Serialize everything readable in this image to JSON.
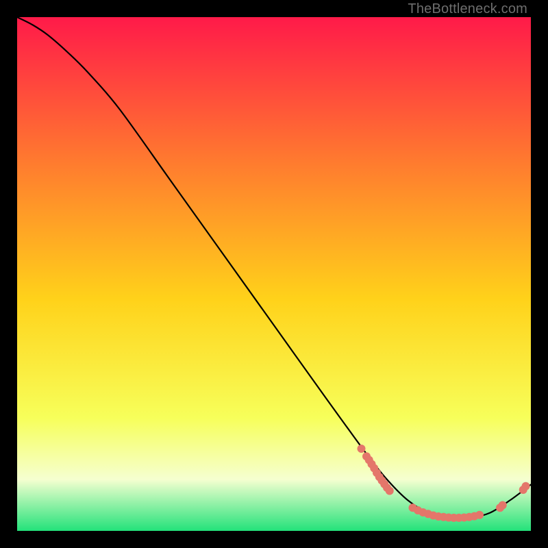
{
  "watermark": "TheBottleneck.com",
  "colors": {
    "top": "#ff1a49",
    "mid_upper": "#ff7a2f",
    "mid": "#ffd21a",
    "mid_lower": "#f7ff5a",
    "pale": "#f5ffd0",
    "green": "#23e27a",
    "curve": "#000000",
    "dot": "#e4766a",
    "bg": "#000000"
  },
  "chart_data": {
    "type": "line",
    "title": "",
    "xlabel": "",
    "ylabel": "",
    "xlim": [
      0,
      100
    ],
    "ylim": [
      0,
      100
    ],
    "curve": {
      "x": [
        0,
        3,
        6,
        10,
        14,
        20,
        30,
        40,
        50,
        60,
        68,
        72,
        76,
        80,
        84,
        88,
        92,
        96,
        100
      ],
      "y": [
        100,
        98.5,
        96.5,
        93,
        89,
        82,
        68,
        54,
        40,
        26,
        15,
        10,
        6,
        3.5,
        2.5,
        2.5,
        3.5,
        6,
        9
      ]
    },
    "dot_clusters": [
      {
        "name": "left-cluster",
        "points": [
          [
            67,
            16
          ],
          [
            68,
            14.5
          ],
          [
            68.5,
            13.8
          ],
          [
            69,
            13
          ],
          [
            69.5,
            12.2
          ],
          [
            70,
            11.3
          ],
          [
            70.5,
            10.5
          ],
          [
            71,
            9.8
          ],
          [
            71.5,
            9.1
          ],
          [
            72,
            8.4
          ],
          [
            72.5,
            7.8
          ]
        ]
      },
      {
        "name": "bottom-cluster",
        "points": [
          [
            77,
            4.5
          ],
          [
            78,
            4.0
          ],
          [
            79,
            3.6
          ],
          [
            80,
            3.3
          ],
          [
            81,
            3.0
          ],
          [
            82,
            2.8
          ],
          [
            83,
            2.7
          ],
          [
            84,
            2.6
          ],
          [
            85,
            2.55
          ],
          [
            86,
            2.55
          ],
          [
            87,
            2.6
          ],
          [
            88,
            2.7
          ],
          [
            89,
            2.85
          ],
          [
            90,
            3.1
          ]
        ]
      },
      {
        "name": "right-cluster",
        "points": [
          [
            94,
            4.5
          ],
          [
            94.5,
            5.0
          ],
          [
            98.5,
            8.0
          ],
          [
            99,
            8.7
          ]
        ]
      }
    ]
  }
}
